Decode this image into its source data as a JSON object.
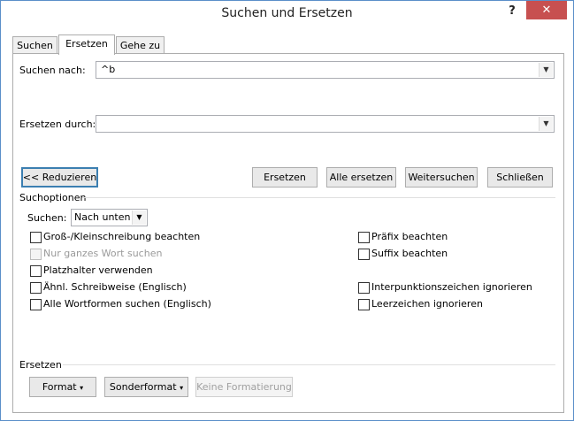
{
  "window": {
    "title": "Suchen und Ersetzen",
    "help": "?",
    "close": "✕"
  },
  "tabs": [
    {
      "label": "Suchen"
    },
    {
      "label": "Ersetzen"
    },
    {
      "label": "Gehe zu"
    }
  ],
  "find": {
    "label": "Suchen nach:",
    "value": "^b"
  },
  "replace": {
    "label": "Ersetzen durch:",
    "value": ""
  },
  "buttons": {
    "reduce": "<< Reduzieren",
    "replace": "Ersetzen",
    "replace_all": "Alle ersetzen",
    "find_next": "Weitersuchen",
    "close": "Schließen"
  },
  "options": {
    "heading": "Suchoptionen",
    "search_label": "Suchen:",
    "search_direction": "Nach unten",
    "left": [
      {
        "label": "Groß-/Kleinschreibung beachten",
        "checked": false,
        "enabled": true
      },
      {
        "label": "Nur ganzes Wort suchen",
        "checked": false,
        "enabled": false
      },
      {
        "label": "Platzhalter verwenden",
        "checked": false,
        "enabled": true
      },
      {
        "label": "Ähnl. Schreibweise (Englisch)",
        "checked": false,
        "enabled": true
      },
      {
        "label": "Alle Wortformen suchen (Englisch)",
        "checked": false,
        "enabled": true
      }
    ],
    "right": [
      {
        "label": "Präfix beachten",
        "checked": false,
        "enabled": true
      },
      {
        "label": "Suffix beachten",
        "checked": false,
        "enabled": true
      },
      {
        "label": "Interpunktionszeichen ignorieren",
        "checked": false,
        "enabled": true
      },
      {
        "label": "Leerzeichen ignorieren",
        "checked": false,
        "enabled": true
      }
    ]
  },
  "replace_section": {
    "heading": "Ersetzen",
    "format": "Format",
    "special": "Sonderformat",
    "no_format": "Keine Formatierung"
  }
}
